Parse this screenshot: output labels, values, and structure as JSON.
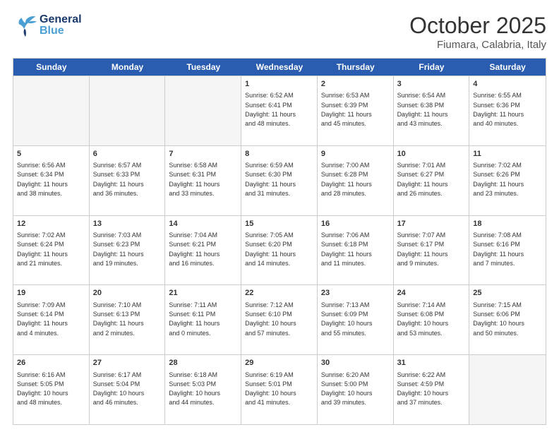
{
  "header": {
    "logo_general": "General",
    "logo_blue": "Blue",
    "month": "October 2025",
    "location": "Fiumara, Calabria, Italy"
  },
  "weekdays": [
    "Sunday",
    "Monday",
    "Tuesday",
    "Wednesday",
    "Thursday",
    "Friday",
    "Saturday"
  ],
  "rows": [
    [
      {
        "day": "",
        "text": ""
      },
      {
        "day": "",
        "text": ""
      },
      {
        "day": "",
        "text": ""
      },
      {
        "day": "1",
        "text": "Sunrise: 6:52 AM\nSunset: 6:41 PM\nDaylight: 11 hours\nand 48 minutes."
      },
      {
        "day": "2",
        "text": "Sunrise: 6:53 AM\nSunset: 6:39 PM\nDaylight: 11 hours\nand 45 minutes."
      },
      {
        "day": "3",
        "text": "Sunrise: 6:54 AM\nSunset: 6:38 PM\nDaylight: 11 hours\nand 43 minutes."
      },
      {
        "day": "4",
        "text": "Sunrise: 6:55 AM\nSunset: 6:36 PM\nDaylight: 11 hours\nand 40 minutes."
      }
    ],
    [
      {
        "day": "5",
        "text": "Sunrise: 6:56 AM\nSunset: 6:34 PM\nDaylight: 11 hours\nand 38 minutes."
      },
      {
        "day": "6",
        "text": "Sunrise: 6:57 AM\nSunset: 6:33 PM\nDaylight: 11 hours\nand 36 minutes."
      },
      {
        "day": "7",
        "text": "Sunrise: 6:58 AM\nSunset: 6:31 PM\nDaylight: 11 hours\nand 33 minutes."
      },
      {
        "day": "8",
        "text": "Sunrise: 6:59 AM\nSunset: 6:30 PM\nDaylight: 11 hours\nand 31 minutes."
      },
      {
        "day": "9",
        "text": "Sunrise: 7:00 AM\nSunset: 6:28 PM\nDaylight: 11 hours\nand 28 minutes."
      },
      {
        "day": "10",
        "text": "Sunrise: 7:01 AM\nSunset: 6:27 PM\nDaylight: 11 hours\nand 26 minutes."
      },
      {
        "day": "11",
        "text": "Sunrise: 7:02 AM\nSunset: 6:26 PM\nDaylight: 11 hours\nand 23 minutes."
      }
    ],
    [
      {
        "day": "12",
        "text": "Sunrise: 7:02 AM\nSunset: 6:24 PM\nDaylight: 11 hours\nand 21 minutes."
      },
      {
        "day": "13",
        "text": "Sunrise: 7:03 AM\nSunset: 6:23 PM\nDaylight: 11 hours\nand 19 minutes."
      },
      {
        "day": "14",
        "text": "Sunrise: 7:04 AM\nSunset: 6:21 PM\nDaylight: 11 hours\nand 16 minutes."
      },
      {
        "day": "15",
        "text": "Sunrise: 7:05 AM\nSunset: 6:20 PM\nDaylight: 11 hours\nand 14 minutes."
      },
      {
        "day": "16",
        "text": "Sunrise: 7:06 AM\nSunset: 6:18 PM\nDaylight: 11 hours\nand 11 minutes."
      },
      {
        "day": "17",
        "text": "Sunrise: 7:07 AM\nSunset: 6:17 PM\nDaylight: 11 hours\nand 9 minutes."
      },
      {
        "day": "18",
        "text": "Sunrise: 7:08 AM\nSunset: 6:16 PM\nDaylight: 11 hours\nand 7 minutes."
      }
    ],
    [
      {
        "day": "19",
        "text": "Sunrise: 7:09 AM\nSunset: 6:14 PM\nDaylight: 11 hours\nand 4 minutes."
      },
      {
        "day": "20",
        "text": "Sunrise: 7:10 AM\nSunset: 6:13 PM\nDaylight: 11 hours\nand 2 minutes."
      },
      {
        "day": "21",
        "text": "Sunrise: 7:11 AM\nSunset: 6:11 PM\nDaylight: 11 hours\nand 0 minutes."
      },
      {
        "day": "22",
        "text": "Sunrise: 7:12 AM\nSunset: 6:10 PM\nDaylight: 10 hours\nand 57 minutes."
      },
      {
        "day": "23",
        "text": "Sunrise: 7:13 AM\nSunset: 6:09 PM\nDaylight: 10 hours\nand 55 minutes."
      },
      {
        "day": "24",
        "text": "Sunrise: 7:14 AM\nSunset: 6:08 PM\nDaylight: 10 hours\nand 53 minutes."
      },
      {
        "day": "25",
        "text": "Sunrise: 7:15 AM\nSunset: 6:06 PM\nDaylight: 10 hours\nand 50 minutes."
      }
    ],
    [
      {
        "day": "26",
        "text": "Sunrise: 6:16 AM\nSunset: 5:05 PM\nDaylight: 10 hours\nand 48 minutes."
      },
      {
        "day": "27",
        "text": "Sunrise: 6:17 AM\nSunset: 5:04 PM\nDaylight: 10 hours\nand 46 minutes."
      },
      {
        "day": "28",
        "text": "Sunrise: 6:18 AM\nSunset: 5:03 PM\nDaylight: 10 hours\nand 44 minutes."
      },
      {
        "day": "29",
        "text": "Sunrise: 6:19 AM\nSunset: 5:01 PM\nDaylight: 10 hours\nand 41 minutes."
      },
      {
        "day": "30",
        "text": "Sunrise: 6:20 AM\nSunset: 5:00 PM\nDaylight: 10 hours\nand 39 minutes."
      },
      {
        "day": "31",
        "text": "Sunrise: 6:22 AM\nSunset: 4:59 PM\nDaylight: 10 hours\nand 37 minutes."
      },
      {
        "day": "",
        "text": ""
      }
    ]
  ]
}
